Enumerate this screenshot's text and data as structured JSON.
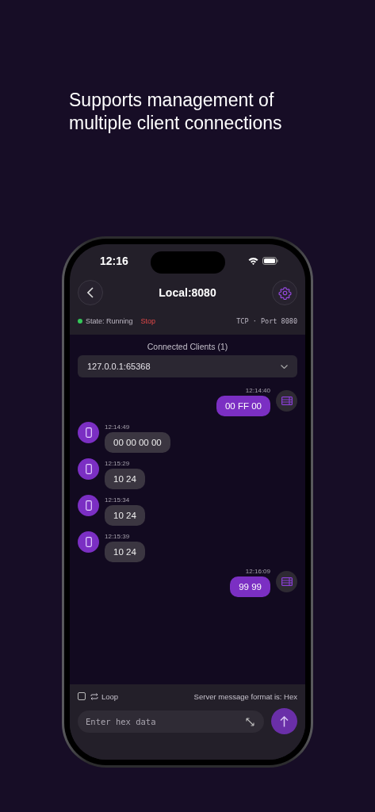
{
  "headline": "Supports management of multiple client connections",
  "status_bar": {
    "time": "12:16"
  },
  "header": {
    "title": "Local:8080"
  },
  "server": {
    "state": "State: Running",
    "running": true,
    "stop_label": "Stop",
    "info": "TCP · Port 8080"
  },
  "clients": {
    "title": "Connected Clients (1)",
    "selected": "127.0.0.1:65368"
  },
  "messages": [
    {
      "kind": "sent",
      "time": "12:14:40",
      "text": "00 FF 00"
    },
    {
      "kind": "received",
      "time": "12:14:49",
      "text": "00 00 00 00"
    },
    {
      "kind": "received",
      "time": "12:15:29",
      "text": "10 24"
    },
    {
      "kind": "received",
      "time": "12:15:34",
      "text": "10 24"
    },
    {
      "kind": "received",
      "time": "12:15:39",
      "text": "10 24"
    },
    {
      "kind": "sent",
      "time": "12:16:09",
      "text": "99 99"
    }
  ],
  "composer": {
    "loop_checked": false,
    "loop_label": "Loop",
    "format": "Server message format is: Hex",
    "placeholder": "Enter hex data"
  }
}
